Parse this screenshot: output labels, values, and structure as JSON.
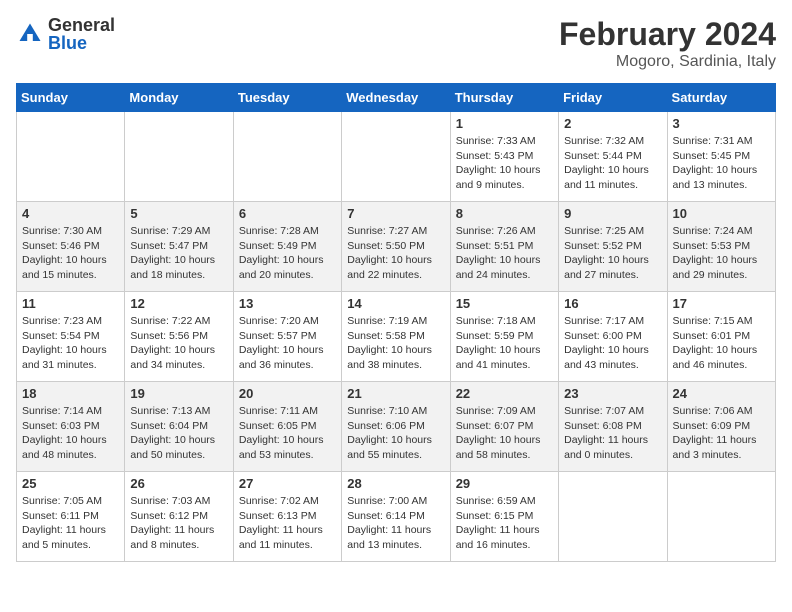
{
  "logo": {
    "general": "General",
    "blue": "Blue"
  },
  "title": {
    "month": "February 2024",
    "location": "Mogoro, Sardinia, Italy"
  },
  "days_of_week": [
    "Sunday",
    "Monday",
    "Tuesday",
    "Wednesday",
    "Thursday",
    "Friday",
    "Saturday"
  ],
  "rows": [
    {
      "cells": [
        {
          "empty": true
        },
        {
          "empty": true
        },
        {
          "empty": true
        },
        {
          "empty": true
        },
        {
          "day": 1,
          "sunrise": "7:33 AM",
          "sunset": "5:43 PM",
          "daylight": "10 hours and 9 minutes."
        },
        {
          "day": 2,
          "sunrise": "7:32 AM",
          "sunset": "5:44 PM",
          "daylight": "10 hours and 11 minutes."
        },
        {
          "day": 3,
          "sunrise": "7:31 AM",
          "sunset": "5:45 PM",
          "daylight": "10 hours and 13 minutes."
        }
      ]
    },
    {
      "cells": [
        {
          "day": 4,
          "sunrise": "7:30 AM",
          "sunset": "5:46 PM",
          "daylight": "10 hours and 15 minutes."
        },
        {
          "day": 5,
          "sunrise": "7:29 AM",
          "sunset": "5:47 PM",
          "daylight": "10 hours and 18 minutes."
        },
        {
          "day": 6,
          "sunrise": "7:28 AM",
          "sunset": "5:49 PM",
          "daylight": "10 hours and 20 minutes."
        },
        {
          "day": 7,
          "sunrise": "7:27 AM",
          "sunset": "5:50 PM",
          "daylight": "10 hours and 22 minutes."
        },
        {
          "day": 8,
          "sunrise": "7:26 AM",
          "sunset": "5:51 PM",
          "daylight": "10 hours and 24 minutes."
        },
        {
          "day": 9,
          "sunrise": "7:25 AM",
          "sunset": "5:52 PM",
          "daylight": "10 hours and 27 minutes."
        },
        {
          "day": 10,
          "sunrise": "7:24 AM",
          "sunset": "5:53 PM",
          "daylight": "10 hours and 29 minutes."
        }
      ]
    },
    {
      "cells": [
        {
          "day": 11,
          "sunrise": "7:23 AM",
          "sunset": "5:54 PM",
          "daylight": "10 hours and 31 minutes."
        },
        {
          "day": 12,
          "sunrise": "7:22 AM",
          "sunset": "5:56 PM",
          "daylight": "10 hours and 34 minutes."
        },
        {
          "day": 13,
          "sunrise": "7:20 AM",
          "sunset": "5:57 PM",
          "daylight": "10 hours and 36 minutes."
        },
        {
          "day": 14,
          "sunrise": "7:19 AM",
          "sunset": "5:58 PM",
          "daylight": "10 hours and 38 minutes."
        },
        {
          "day": 15,
          "sunrise": "7:18 AM",
          "sunset": "5:59 PM",
          "daylight": "10 hours and 41 minutes."
        },
        {
          "day": 16,
          "sunrise": "7:17 AM",
          "sunset": "6:00 PM",
          "daylight": "10 hours and 43 minutes."
        },
        {
          "day": 17,
          "sunrise": "7:15 AM",
          "sunset": "6:01 PM",
          "daylight": "10 hours and 46 minutes."
        }
      ]
    },
    {
      "cells": [
        {
          "day": 18,
          "sunrise": "7:14 AM",
          "sunset": "6:03 PM",
          "daylight": "10 hours and 48 minutes."
        },
        {
          "day": 19,
          "sunrise": "7:13 AM",
          "sunset": "6:04 PM",
          "daylight": "10 hours and 50 minutes."
        },
        {
          "day": 20,
          "sunrise": "7:11 AM",
          "sunset": "6:05 PM",
          "daylight": "10 hours and 53 minutes."
        },
        {
          "day": 21,
          "sunrise": "7:10 AM",
          "sunset": "6:06 PM",
          "daylight": "10 hours and 55 minutes."
        },
        {
          "day": 22,
          "sunrise": "7:09 AM",
          "sunset": "6:07 PM",
          "daylight": "10 hours and 58 minutes."
        },
        {
          "day": 23,
          "sunrise": "7:07 AM",
          "sunset": "6:08 PM",
          "daylight": "11 hours and 0 minutes."
        },
        {
          "day": 24,
          "sunrise": "7:06 AM",
          "sunset": "6:09 PM",
          "daylight": "11 hours and 3 minutes."
        }
      ]
    },
    {
      "cells": [
        {
          "day": 25,
          "sunrise": "7:05 AM",
          "sunset": "6:11 PM",
          "daylight": "11 hours and 5 minutes."
        },
        {
          "day": 26,
          "sunrise": "7:03 AM",
          "sunset": "6:12 PM",
          "daylight": "11 hours and 8 minutes."
        },
        {
          "day": 27,
          "sunrise": "7:02 AM",
          "sunset": "6:13 PM",
          "daylight": "11 hours and 11 minutes."
        },
        {
          "day": 28,
          "sunrise": "7:00 AM",
          "sunset": "6:14 PM",
          "daylight": "11 hours and 13 minutes."
        },
        {
          "day": 29,
          "sunrise": "6:59 AM",
          "sunset": "6:15 PM",
          "daylight": "11 hours and 16 minutes."
        },
        {
          "empty": true
        },
        {
          "empty": true
        }
      ]
    }
  ],
  "labels": {
    "sunrise": "Sunrise:",
    "sunset": "Sunset:",
    "daylight": "Daylight:"
  }
}
